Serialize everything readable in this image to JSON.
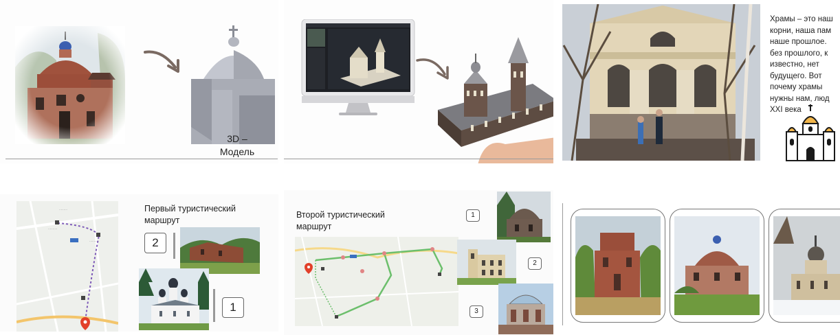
{
  "panel_1": {
    "model_caption": "3D –\nМодель"
  },
  "panel_3": {
    "quote": "Храмы – это наш\nкорни, наша пам\nнаше прошлое.\nбез прошлого, к\nизвестно, нет\nбудущего. Вот\nпочему храмы\nнужны нам, люд\nXXI века"
  },
  "panel_4": {
    "title": "Первый туристический маршрут",
    "label_2": "2",
    "label_1": "1"
  },
  "panel_5": {
    "title": "Второй туристический маршрут",
    "label_1": "1",
    "label_2": "2",
    "label_3": "3"
  },
  "colors": {
    "brick": "#a0523d",
    "dome_blue": "#3b5fb0",
    "route_purple": "#7d5ab8",
    "route_green": "#6cbf6c",
    "pin_red": "#e2402a",
    "model_grey": "#a9acb5"
  }
}
